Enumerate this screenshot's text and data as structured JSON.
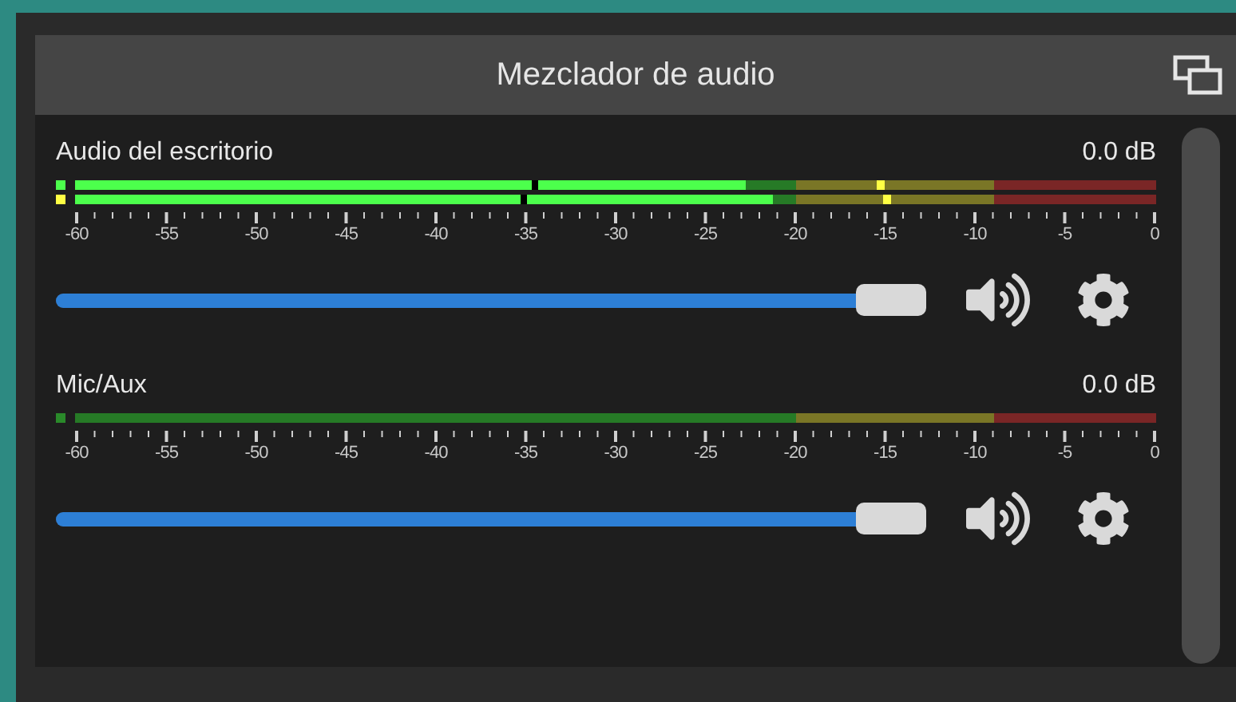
{
  "panel": {
    "title": "Mezclador de audio"
  },
  "channels": [
    {
      "name": "Audio del escritorio",
      "reading": "0.0 dB",
      "muted": false,
      "volume": {
        "level": 1
      },
      "scale": [
        "-60",
        "-55",
        "-50",
        "-45",
        "-40",
        "-35",
        "-30",
        "-25",
        "-20",
        "-15",
        "-10",
        "-5",
        "0"
      ],
      "bars": [
        {
          "indicator": {
            "color": "#4cff4c"
          },
          "level": 0.62,
          "peak": {
            "level": 0.745
          },
          "hold": {
            "level": 0.425
          }
        },
        {
          "indicator": {
            "color": "#ffff44"
          },
          "level": 0.645,
          "peak": {
            "level": 0.75
          },
          "hold": {
            "level": 0.415
          }
        }
      ]
    },
    {
      "name": "Mic/Aux",
      "reading": "0.0 dB",
      "muted": false,
      "volume": {
        "level": 1
      },
      "scale": [
        "-60",
        "-55",
        "-50",
        "-45",
        "-40",
        "-35",
        "-30",
        "-25",
        "-20",
        "-15",
        "-10",
        "-5",
        "0"
      ],
      "bars": [
        {
          "indicator": {
            "color": "#2a8a2a"
          }
        }
      ]
    }
  ]
}
